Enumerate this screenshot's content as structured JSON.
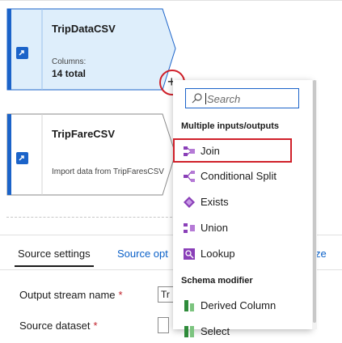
{
  "nodes": [
    {
      "title": "TripDataCSV",
      "sub_label": "Columns:",
      "value": "14 total",
      "selected": true
    },
    {
      "title": "TripFareCSV",
      "sub_label": "Import data from TripFaresCSV",
      "selected": false
    }
  ],
  "add_button": {
    "symbol": "+"
  },
  "menu": {
    "search_placeholder": "Search",
    "sections": [
      {
        "title": "Multiple inputs/outputs",
        "items": [
          {
            "label": "Join",
            "icon": "join-icon",
            "highlighted": true
          },
          {
            "label": "Conditional Split",
            "icon": "conditional-split-icon"
          },
          {
            "label": "Exists",
            "icon": "exists-icon"
          },
          {
            "label": "Union",
            "icon": "union-icon"
          },
          {
            "label": "Lookup",
            "icon": "lookup-icon"
          }
        ]
      },
      {
        "title": "Schema modifier",
        "items": [
          {
            "label": "Derived Column",
            "icon": "derived-column-icon"
          },
          {
            "label": "Select",
            "icon": "select-icon"
          }
        ]
      }
    ]
  },
  "panel": {
    "tabs": [
      "Source settings",
      "Source opt",
      "ze"
    ],
    "fields": [
      {
        "label": "Output stream name",
        "required": "*",
        "value": "Tr"
      },
      {
        "label": "Source dataset",
        "required": "*"
      }
    ]
  },
  "colors": {
    "selected_node_fill": "#deeefb",
    "node_accent": "#1b63c9",
    "highlight_red": "#d0202a",
    "link_blue": "#0a60c8",
    "icon_purple": "#8a3fb8"
  }
}
